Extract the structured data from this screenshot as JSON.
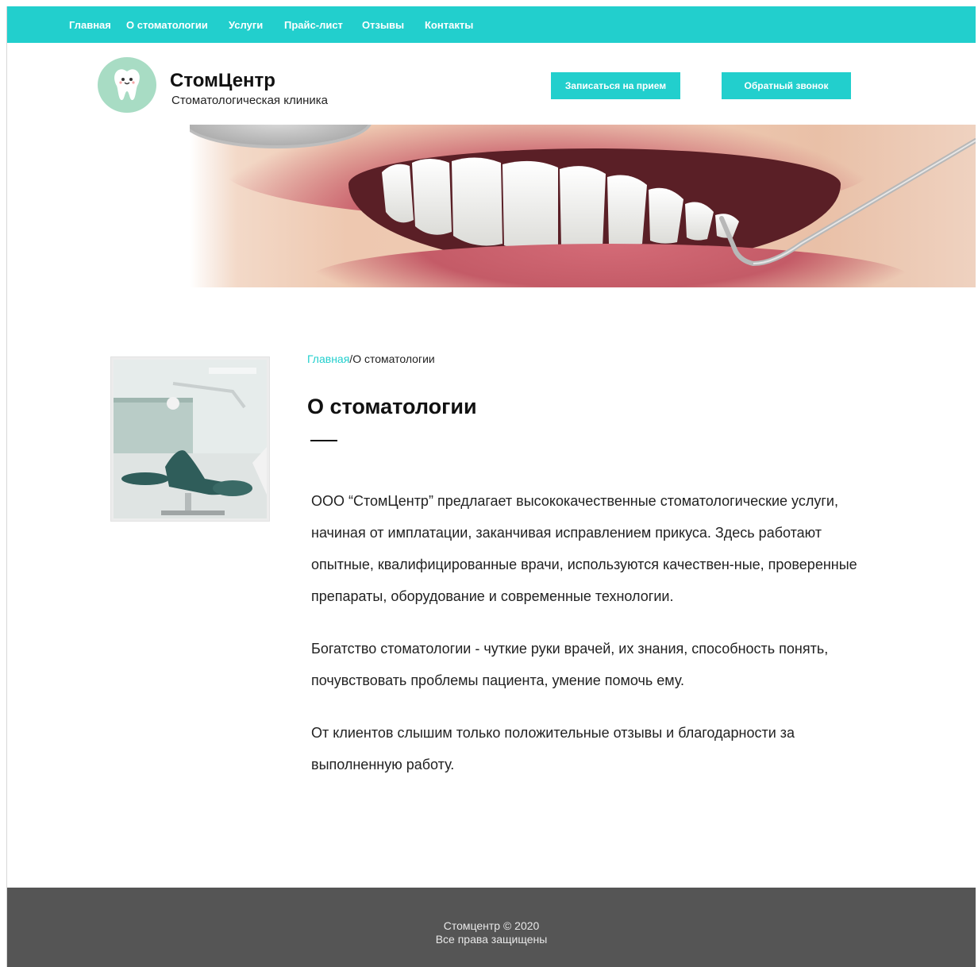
{
  "nav": {
    "items": [
      {
        "label": "Главная"
      },
      {
        "label": "О стоматологии"
      },
      {
        "label": "Услуги"
      },
      {
        "label": "Прайс-лист"
      },
      {
        "label": "Отзывы"
      },
      {
        "label": "Контакты"
      }
    ]
  },
  "header": {
    "brand_name": "СтомЦентр",
    "brand_subtitle": "Стоматологическая клиника",
    "logo_icon": "tooth-icon",
    "appointment_button": "Записаться на прием",
    "callback_button": "Обратный звонок"
  },
  "breadcrumb": {
    "home": "Главная",
    "separator": "/",
    "current": "О стоматологии"
  },
  "main": {
    "title": "О стоматологии",
    "paragraphs": [
      "ООО “СтомЦентр” предлагает высококачественные стоматологические услуги, начиная от имплатации, заканчивая исправлением прикуса. Здесь работают опытные, квалифицированные врачи, используются качествен-ные, проверенные препараты, оборудование и современные технологии.",
      "Богатство стоматологии - чуткие руки врачей, их знания, способность понять, почувствовать проблемы пациента, умение помочь ему.",
      "От клиентов слышим только положительные отзывы и благодарности за выполненную работу."
    ]
  },
  "footer": {
    "copyright": "Стомцентр © 2020",
    "rights": "Все права защищены"
  },
  "colors": {
    "accent": "#22cfcd",
    "footer_bg": "#555555",
    "logo_bg": "#a8dcc4"
  }
}
